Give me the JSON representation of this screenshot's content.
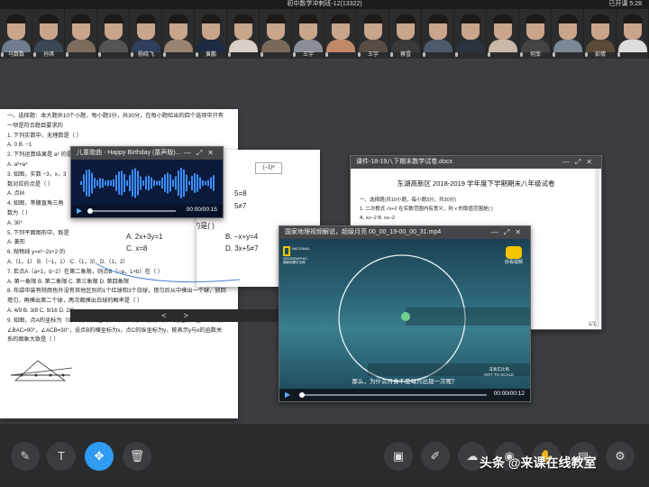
{
  "topbar": {
    "title": "初中数学冲刺班-12(13322)",
    "timer": "已开课 5:28"
  },
  "participants": [
    {
      "name": "马数数",
      "shirt": "#6f7d8e"
    },
    {
      "name": "孙琪",
      "shirt": "#3b4655"
    },
    {
      "name": "",
      "shirt": "#7c6c5c"
    },
    {
      "name": "",
      "shirt": "#555555"
    },
    {
      "name": "杨晓飞",
      "shirt": "#2f3e5c"
    },
    {
      "name": "",
      "shirt": "#9a8370"
    },
    {
      "name": "黄鹏",
      "shirt": "#1d2a44"
    },
    {
      "name": "",
      "shirt": "#d8d0c8"
    },
    {
      "name": "",
      "shirt": "#7a6a5c"
    },
    {
      "name": "王宇",
      "shirt": "#8a8f96"
    },
    {
      "name": "",
      "shirt": "#c08a6a"
    },
    {
      "name": "王宇",
      "shirt": "#584c44"
    },
    {
      "name": "蔡雪",
      "shirt": "#3a3a3a"
    },
    {
      "name": "",
      "shirt": "#4d5a6a"
    },
    {
      "name": "",
      "shirt": "#2b3340"
    },
    {
      "name": "",
      "shirt": "#c9b8a8"
    },
    {
      "name": "何菲",
      "shirt": "#444444"
    },
    {
      "name": "",
      "shirt": "#7b8795"
    },
    {
      "name": "彭倩",
      "shirt": "#5a4a3a"
    },
    {
      "name": "",
      "shirt": "#dddddd"
    }
  ],
  "left_doc": {
    "lines": [
      "一、选择题：本大题共10个小题，每小题3分，共30分，在每小题给出的四个选项中只有",
      "一项是符合题目要求的",
      "1. 下列实数中，无理数是（    ）",
      "A. 0          B. −1",
      "2. 下列运算结果是 a⁶ 的是",
      "A. a²+a⁴",
      "3. 如图，实数 −3，x，3",
      "数对应的点是（    ）",
      "A. 点M",
      "4. 如图，等腰直角三角",
      "数为（    ）",
      "",
      "A. 30°",
      "5. 下列平面图形中，既是",
      "A. 菱形",
      "6. 抛物线 y=x²−2x+2 的",
      "A.（1，1）     B.（−1，1）     C.（1，3）     D.（1，2）",
      "7. 若点A（a+1，b−2）在第二象限，则点B（−a，1+b）在（    ）",
      "A. 第一象限     B. 第二象限     C. 第三象限     D. 第四象限",
      "8. 布袋中装有除颜色外没有其他区别的1个红球和3个白球，搅匀后从中摸出一个球，放回",
      "搅匀，再摸出第二个球，两次都摸出白球的概率是（    ）",
      "A. 4/9     B. 3/8     C. 9/16     D. 2/3",
      "9. 如图，点A的坐标为（0，1），点B是x轴正半轴上的一动点，以AB为边作Rt△ABC，使",
      "∠BAC=90°，∠ACB=30°，设点B的横坐标为x，点C的纵坐标为y，能表示y与x的函数关",
      "系的图象大致是（    ）"
    ]
  },
  "mid_card": {
    "frac": "(−1)ᵃ",
    "q_num": "2",
    "question": "下列各式中不是方程的是(    )",
    "opt_a": "A.  2x+3y=1",
    "opt_b": "B.  −x+y=4",
    "opt_c": "C.  x=8",
    "opt_d": "D.  3x+5≠7",
    "cut1": "5=8",
    "cut2": "5≠7"
  },
  "audio_window": {
    "title": "儿童歌曲 - Happy Birthday (童声版)...",
    "time": "00:00/00:15"
  },
  "right_doc_window": {
    "title": "课件-18-19八下期末数学试卷.docx",
    "heading": "东湖高新区 2018-2019 学年度下学期期末八年级试卷",
    "sub": "一、选择题(共10小题，每小题3分，共30分)",
    "line1": "1. 二次根式 √x+2 在实数范围内有意义，则 x 的取值范围是(    )",
    "line2": "A. x≥−2     B. x≤−2",
    "page": "1/1"
  },
  "video_window": {
    "title": "国家地理视频解说，超级月亮 00_00_19-00_00_31.mp4",
    "brand_top": "NATIONAL",
    "brand_bottom": "GEOGRAPHIC",
    "brand_note": "国家地理中文网",
    "app_name": "好看视频",
    "scale1": "非真实比例",
    "scale2": "NOT TO SCALE",
    "subtitle": "那么，为什么月食不是每月出现一次呢？",
    "time": "00:00/00:12"
  },
  "pager": {
    "prev": "<",
    "next": ">"
  },
  "toolbar": {
    "left": [
      {
        "icon": "pencil-icon",
        "glyph": "✎"
      },
      {
        "icon": "text-icon",
        "glyph": "T"
      },
      {
        "icon": "move-icon",
        "glyph": "✥"
      },
      {
        "icon": "trash-icon",
        "glyph": "🗑"
      }
    ],
    "right": [
      {
        "icon": "save-icon",
        "glyph": "▣"
      },
      {
        "icon": "pen-icon",
        "glyph": "✐"
      },
      {
        "icon": "cloud-icon",
        "glyph": "☁"
      },
      {
        "icon": "camera-icon",
        "glyph": "◉"
      },
      {
        "icon": "hand-icon",
        "glyph": "✋"
      },
      {
        "icon": "chat-icon",
        "glyph": "▤"
      },
      {
        "icon": "settings-icon",
        "glyph": "⚙"
      }
    ]
  },
  "watermark": "头条 @来课在线教室",
  "colors": {
    "accent": "#2f9bf2",
    "wave": "#3d8cff",
    "badge": "#f07d1a"
  }
}
